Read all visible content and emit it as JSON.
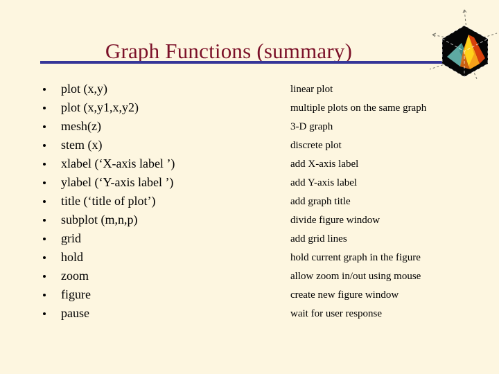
{
  "slide": {
    "title": "Graph Functions (summary)",
    "title_color": "#7b1028",
    "rule_color": "#363698",
    "background_color": "#fdf6e0",
    "text_color": "#000000",
    "bullet_glyph": "•"
  },
  "logo": {
    "name": "matlab-membrane-logo",
    "body_color": "#050505",
    "peak_colors": [
      "#ffd21a",
      "#ff8c00",
      "#e8480d",
      "#a02000"
    ],
    "lobe_color": "#63b3ac",
    "axis_color": "#444444"
  },
  "list": {
    "items": [
      {
        "command": "plot (x,y)",
        "description": "linear plot"
      },
      {
        "command": "plot (x,y1,x,y2)",
        "description": "multiple plots on the same graph"
      },
      {
        "command": "mesh(z)",
        "description": "3-D graph"
      },
      {
        "command": "stem  (x)",
        "description": "discrete plot"
      },
      {
        "command": "xlabel (‘X-axis label ’)",
        "description": "add X-axis label"
      },
      {
        "command": "ylabel (‘Y-axis label ’)",
        "description": "add Y-axis label"
      },
      {
        "command": "title (‘title of plot’)",
        "description": "add graph title"
      },
      {
        "command": "subplot (m,n,p)",
        "description": "divide figure window"
      },
      {
        "command": "grid",
        "description": "add grid lines"
      },
      {
        "command": "hold",
        "description": "hold current graph in the figure"
      },
      {
        "command": "zoom",
        "description": "allow zoom in/out using mouse"
      },
      {
        "command": "figure",
        "description": "create new figure window"
      },
      {
        "command": "pause",
        "description": "wait for user response"
      }
    ]
  }
}
